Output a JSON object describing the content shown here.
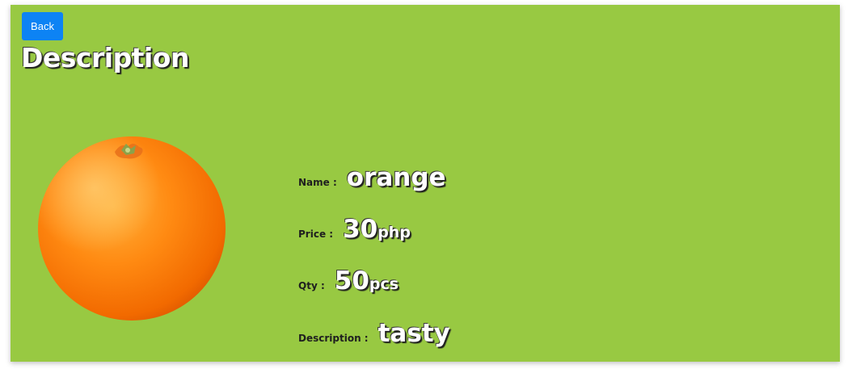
{
  "back_button": {
    "label": "Back"
  },
  "page_title": "Description",
  "product_image": {
    "icon": "orange-fruit-image"
  },
  "details": {
    "name": {
      "label": "Name :",
      "value": "orange"
    },
    "price": {
      "label": "Price :",
      "value": "30",
      "unit": "php"
    },
    "qty": {
      "label": "Qty :",
      "value": "50",
      "unit": "pcs"
    },
    "description": {
      "label": "Description :",
      "value": "tasty"
    }
  },
  "colors": {
    "background": "#98c942",
    "button": "#0d83f4",
    "title_text": "#ffffff"
  }
}
